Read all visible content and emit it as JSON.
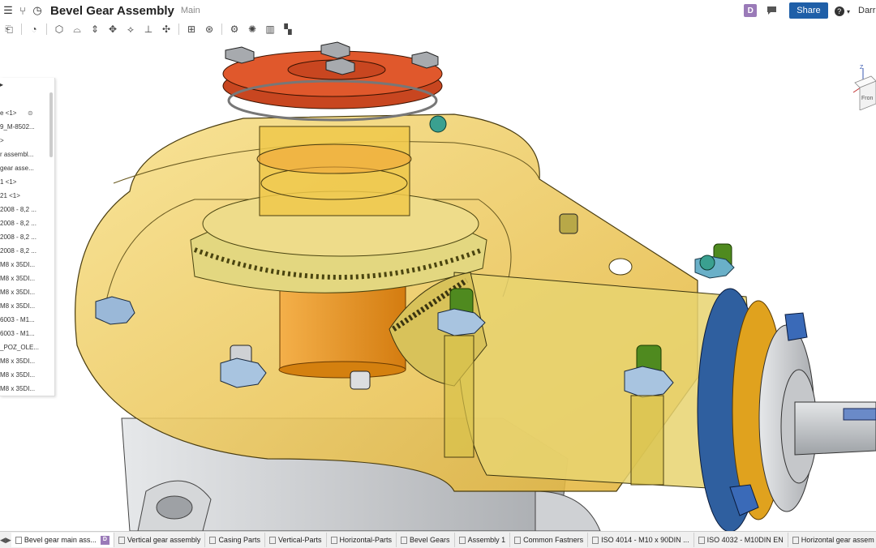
{
  "header": {
    "title": "Bevel Gear Assembly",
    "branch": "Main",
    "badge": "D",
    "share_label": "Share",
    "help_label": "?",
    "user": "Darr"
  },
  "viewcube": {
    "axis": "Z",
    "face": "Fron"
  },
  "panel": {
    "items": [
      "e <1>",
      "9_M-8502...",
      ">",
      "r assembl...",
      "gear asse...",
      "1 <1>",
      "21 <1>",
      "2008 - 8,2 ...",
      "2008 - 8,2 ...",
      "2008 - 8,2 ...",
      "2008 - 8,2 ...",
      "M8 x 35DI...",
      "M8 x 35DI...",
      "M8 x 35DI...",
      "M8 x 35DI...",
      "6003 - M1...",
      "6003 - M1...",
      "_POZ_OLE...",
      "M8 x 35DI...",
      "M8 x 35DI...",
      "M8 x 35DI..."
    ]
  },
  "tabs": [
    {
      "label": "Bevel gear main ass...",
      "active": true,
      "badge": "D"
    },
    {
      "label": "Vertical gear assembly"
    },
    {
      "label": "Casing Parts"
    },
    {
      "label": "Vertical-Parts"
    },
    {
      "label": "Horizontal-Parts"
    },
    {
      "label": "Bevel Gears"
    },
    {
      "label": "Assembly 1"
    },
    {
      "label": "Common Fastners"
    },
    {
      "label": "ISO 4014 - M10 x 90DIN ..."
    },
    {
      "label": "ISO 4032 - M10DIN EN"
    },
    {
      "label": "Horizontal gear assem"
    }
  ],
  "colors": {
    "accent": "#1f5fa8",
    "badge": "#9a7ab8",
    "casing_yellow": "#f2cf52",
    "flange_red": "#d4502a",
    "flange_blue": "#2a5a9a",
    "gear_orange": "#e8961e",
    "housing_grey": "#c8cacd"
  }
}
